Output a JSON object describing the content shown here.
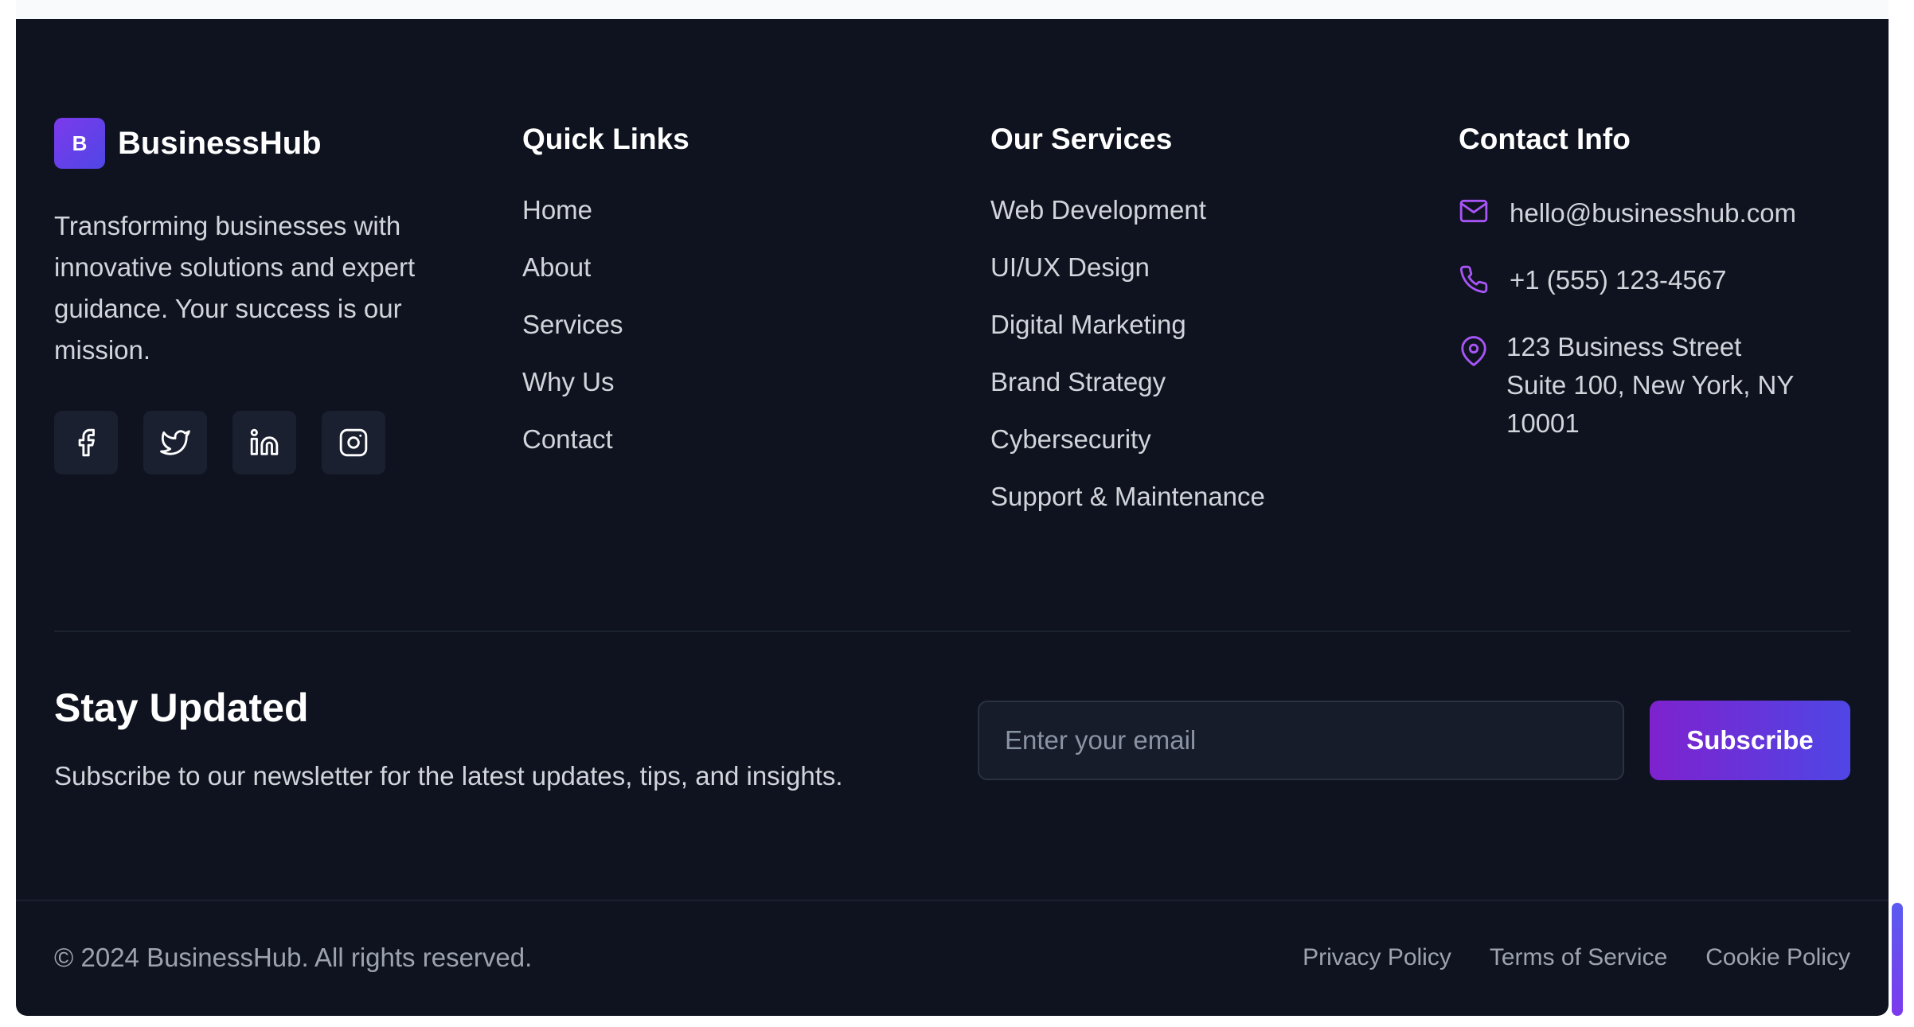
{
  "brand": {
    "logo_letter": "B",
    "name": "BusinessHub",
    "description": "Transforming businesses with innovative solutions and expert guidance. Your success is our mission.",
    "socials": [
      "facebook-icon",
      "twitter-icon",
      "linkedin-icon",
      "instagram-icon"
    ]
  },
  "quick_links": {
    "title": "Quick Links",
    "items": [
      "Home",
      "About",
      "Services",
      "Why Us",
      "Contact"
    ]
  },
  "services": {
    "title": "Our Services",
    "items": [
      "Web Development",
      "UI/UX Design",
      "Digital Marketing",
      "Brand Strategy",
      "Cybersecurity",
      "Support & Maintenance"
    ]
  },
  "contact": {
    "title": "Contact Info",
    "email": "hello@businesshub.com",
    "phone": "+1 (555) 123-4567",
    "address_line1": "123 Business Street",
    "address_line2": "Suite 100, New York, NY",
    "address_line3": "10001"
  },
  "newsletter": {
    "title": "Stay Updated",
    "description": "Subscribe to our newsletter for the latest updates, tips, and insights.",
    "placeholder": "Enter your email",
    "button_label": "Subscribe"
  },
  "bottom": {
    "copyright": "© 2024 BusinessHub. All rights reserved.",
    "legal_links": [
      "Privacy Policy",
      "Terms of Service",
      "Cookie Policy"
    ]
  },
  "colors": {
    "background": "#0f131f",
    "accent": "#7c3aed",
    "accent_secondary": "#4f46e5",
    "icon_accent": "#a855f7"
  }
}
